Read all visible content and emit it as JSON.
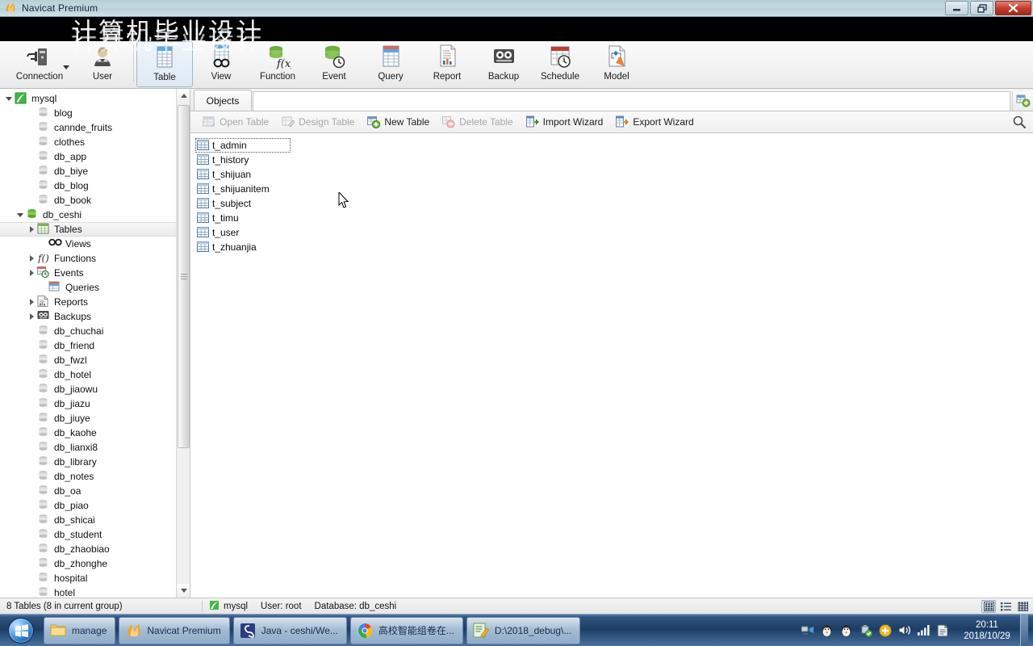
{
  "window": {
    "title": "Navicat Premium",
    "icon": "navicat-logo",
    "minimize_label": "Minimize",
    "maximize_label": "Maximize",
    "close_label": "Close"
  },
  "watermark": {
    "text": "计算机毕业设计"
  },
  "toolbar": {
    "items": [
      {
        "label": "Connection",
        "icon": "connection-icon",
        "has_dropdown": true,
        "selected": false
      },
      {
        "label": "User",
        "icon": "user-icon",
        "has_dropdown": false,
        "selected": false
      },
      {
        "label": "Table",
        "icon": "table-icon",
        "has_dropdown": false,
        "selected": true
      },
      {
        "label": "View",
        "icon": "view-icon",
        "has_dropdown": false,
        "selected": false
      },
      {
        "label": "Function",
        "icon": "function-icon",
        "has_dropdown": false,
        "selected": false
      },
      {
        "label": "Event",
        "icon": "event-icon",
        "has_dropdown": false,
        "selected": false
      },
      {
        "label": "Query",
        "icon": "query-icon",
        "has_dropdown": false,
        "selected": false
      },
      {
        "label": "Report",
        "icon": "report-icon",
        "has_dropdown": false,
        "selected": false
      },
      {
        "label": "Backup",
        "icon": "backup-icon",
        "has_dropdown": false,
        "selected": false
      },
      {
        "label": "Schedule",
        "icon": "schedule-icon",
        "has_dropdown": false,
        "selected": false
      },
      {
        "label": "Model",
        "icon": "model-icon",
        "has_dropdown": false,
        "selected": false
      }
    ]
  },
  "sidebar": {
    "connection": {
      "label": "mysql",
      "icon": "mysql-connection-icon",
      "expanded": true
    },
    "databases": [
      {
        "label": "blog",
        "icon": "database-icon",
        "expanded": false
      },
      {
        "label": "cannde_fruits",
        "icon": "database-icon",
        "expanded": false
      },
      {
        "label": "clothes",
        "icon": "database-icon",
        "expanded": false
      },
      {
        "label": "db_app",
        "icon": "database-icon",
        "expanded": false
      },
      {
        "label": "db_biye",
        "icon": "database-icon",
        "expanded": false
      },
      {
        "label": "db_blog",
        "icon": "database-icon",
        "expanded": false
      },
      {
        "label": "db_book",
        "icon": "database-icon",
        "expanded": false
      },
      {
        "label": "db_ceshi",
        "icon": "database-open-icon",
        "expanded": true
      },
      {
        "label": "db_chuchai",
        "icon": "database-icon",
        "expanded": false
      },
      {
        "label": "db_friend",
        "icon": "database-icon",
        "expanded": false
      },
      {
        "label": "db_fwzl",
        "icon": "database-icon",
        "expanded": false
      },
      {
        "label": "db_hotel",
        "icon": "database-icon",
        "expanded": false
      },
      {
        "label": "db_jiaowu",
        "icon": "database-icon",
        "expanded": false
      },
      {
        "label": "db_jiazu",
        "icon": "database-icon",
        "expanded": false
      },
      {
        "label": "db_jiuye",
        "icon": "database-icon",
        "expanded": false
      },
      {
        "label": "db_kaohe",
        "icon": "database-icon",
        "expanded": false
      },
      {
        "label": "db_lianxi8",
        "icon": "database-icon",
        "expanded": false
      },
      {
        "label": "db_library",
        "icon": "database-icon",
        "expanded": false
      },
      {
        "label": "db_notes",
        "icon": "database-icon",
        "expanded": false
      },
      {
        "label": "db_oa",
        "icon": "database-icon",
        "expanded": false
      },
      {
        "label": "db_piao",
        "icon": "database-icon",
        "expanded": false
      },
      {
        "label": "db_shicai",
        "icon": "database-icon",
        "expanded": false
      },
      {
        "label": "db_student",
        "icon": "database-icon",
        "expanded": false
      },
      {
        "label": "db_zhaobiao",
        "icon": "database-icon",
        "expanded": false
      },
      {
        "label": "db_zhonghe",
        "icon": "database-icon",
        "expanded": false
      },
      {
        "label": "hospital",
        "icon": "database-icon",
        "expanded": false
      },
      {
        "label": "hotel",
        "icon": "database-icon",
        "expanded": false
      }
    ],
    "db_ceshi_children": [
      {
        "label": "Tables",
        "icon": "tables-icon",
        "twisty": true,
        "selected": true
      },
      {
        "label": "Views",
        "icon": "views-icon",
        "twisty": false,
        "selected": false
      },
      {
        "label": "Functions",
        "icon": "functions-icon",
        "twisty": true,
        "selected": false
      },
      {
        "label": "Events",
        "icon": "events-icon",
        "twisty": true,
        "selected": false
      },
      {
        "label": "Queries",
        "icon": "queries-icon",
        "twisty": false,
        "selected": false
      },
      {
        "label": "Reports",
        "icon": "reports-icon",
        "twisty": true,
        "selected": false
      },
      {
        "label": "Backups",
        "icon": "backups-icon",
        "twisty": true,
        "selected": false
      }
    ]
  },
  "main": {
    "tabs": [
      {
        "label": "Objects",
        "active": true
      }
    ],
    "new_tab_icon": "new-object-icon",
    "object_toolbar": {
      "buttons": [
        {
          "label": "Open Table",
          "icon": "open-table-icon",
          "enabled": false
        },
        {
          "label": "Design Table",
          "icon": "design-table-icon",
          "enabled": false
        },
        {
          "label": "New Table",
          "icon": "new-table-icon",
          "enabled": true
        },
        {
          "label": "Delete Table",
          "icon": "delete-table-icon",
          "enabled": false
        },
        {
          "label": "Import Wizard",
          "icon": "import-wizard-icon",
          "enabled": true
        },
        {
          "label": "Export Wizard",
          "icon": "export-wizard-icon",
          "enabled": true
        }
      ],
      "search_icon": "search-icon"
    },
    "tables": [
      {
        "label": "t_admin",
        "icon": "table-item-icon",
        "focused": true
      },
      {
        "label": "t_history",
        "icon": "table-item-icon",
        "focused": false
      },
      {
        "label": "t_shijuan",
        "icon": "table-item-icon",
        "focused": false
      },
      {
        "label": "t_shijuanitem",
        "icon": "table-item-icon",
        "focused": false
      },
      {
        "label": "t_subject",
        "icon": "table-item-icon",
        "focused": false
      },
      {
        "label": "t_timu",
        "icon": "table-item-icon",
        "focused": false
      },
      {
        "label": "t_user",
        "icon": "table-item-icon",
        "focused": false
      },
      {
        "label": "t_zhuanjia",
        "icon": "table-item-icon",
        "focused": false
      }
    ]
  },
  "statusbar": {
    "count_text": "8 Tables (8 in current group)",
    "connection_label": "mysql",
    "user_label": "User: root",
    "database_label": "Database: db_ceshi",
    "view_modes": [
      {
        "name": "grid-view",
        "icon": "grid-view-icon",
        "active": true
      },
      {
        "name": "list-view",
        "icon": "list-view-icon",
        "active": false
      },
      {
        "name": "detail-view",
        "icon": "detail-view-icon",
        "active": false
      }
    ]
  },
  "taskbar": {
    "start_label": "Start",
    "tasks": [
      {
        "label": "manage",
        "icon": "folder-icon"
      },
      {
        "label": "Navicat Premium",
        "icon": "navicat-logo"
      },
      {
        "label": "Java - ceshi/We...",
        "icon": "eclipse-icon"
      },
      {
        "label": "高校智能组卷在...",
        "icon": "chrome-icon"
      },
      {
        "label": "D:\\2018_debug\\...",
        "icon": "editplus-icon"
      }
    ],
    "tray": [
      {
        "name": "network-share-icon"
      },
      {
        "name": "qq-icon"
      },
      {
        "name": "qq-icon-2"
      },
      {
        "name": "antivirus-icon"
      },
      {
        "name": "update-icon"
      },
      {
        "name": "volume-icon"
      },
      {
        "name": "signal-icon"
      },
      {
        "name": "action-center-icon"
      }
    ],
    "clock_time": "20:11",
    "clock_date": "2018/10/29"
  }
}
